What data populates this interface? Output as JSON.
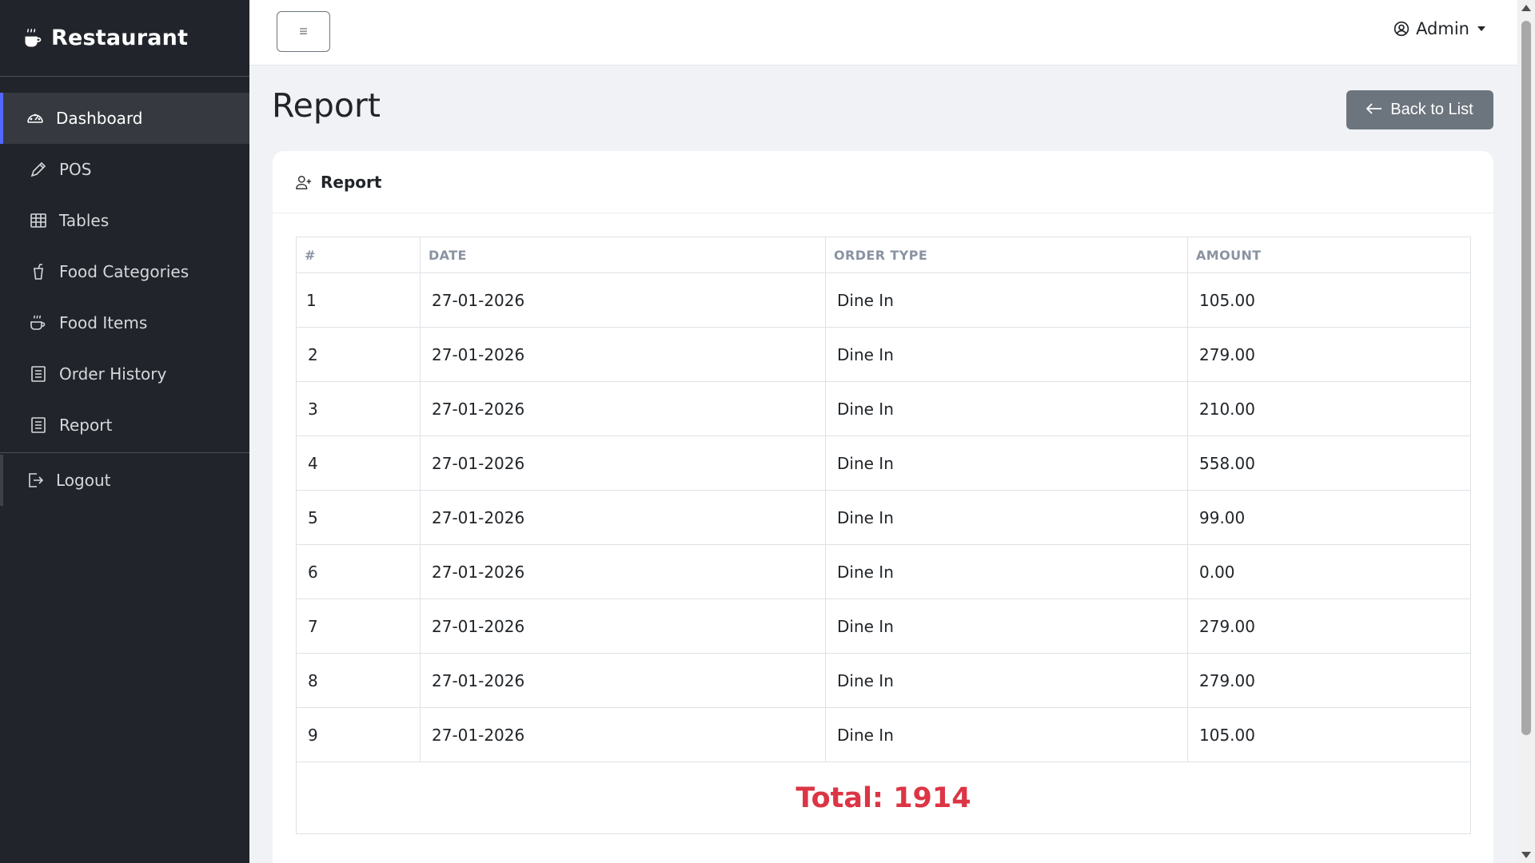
{
  "brand": {
    "name": "Restaurant"
  },
  "sidebar": {
    "items": [
      {
        "label": "Dashboard",
        "icon": "gauge-icon",
        "active": true
      },
      {
        "label": "POS",
        "icon": "pencil-icon"
      },
      {
        "label": "Tables",
        "icon": "table-icon"
      },
      {
        "label": "Food Categories",
        "icon": "cup-icon"
      },
      {
        "label": "Food Items",
        "icon": "cup-hot-icon"
      },
      {
        "label": "Order History",
        "icon": "receipt-icon"
      },
      {
        "label": "Report",
        "icon": "receipt-icon"
      }
    ],
    "logout": {
      "label": "Logout",
      "icon": "logout-icon"
    }
  },
  "topbar": {
    "toggle_icon": "≡",
    "user": {
      "name": "Admin",
      "icon": "person-circle-icon"
    }
  },
  "page": {
    "title": "Report",
    "back_button": {
      "label": "Back to List",
      "icon": "arrow-left-icon"
    }
  },
  "card": {
    "title": "Report",
    "icon": "person-add-icon"
  },
  "table": {
    "headers": [
      "#",
      "DATE",
      "ORDER TYPE",
      "AMOUNT"
    ],
    "rows": [
      [
        "1",
        "27-01-2026",
        "Dine In",
        "105.00"
      ],
      [
        "2",
        "27-01-2026",
        "Dine In",
        "279.00"
      ],
      [
        "3",
        "27-01-2026",
        "Dine In",
        "210.00"
      ],
      [
        "4",
        "27-01-2026",
        "Dine In",
        "558.00"
      ],
      [
        "5",
        "27-01-2026",
        "Dine In",
        "99.00"
      ],
      [
        "6",
        "27-01-2026",
        "Dine In",
        "0.00"
      ],
      [
        "7",
        "27-01-2026",
        "Dine In",
        "279.00"
      ],
      [
        "8",
        "27-01-2026",
        "Dine In",
        "279.00"
      ],
      [
        "9",
        "27-01-2026",
        "Dine In",
        "105.00"
      ]
    ],
    "total": "Total: 1914"
  },
  "colors": {
    "sidebar_bg": "#21252b",
    "active_accent": "#5468ff",
    "total_red": "#dc3545",
    "back_button_bg": "#6c757d"
  }
}
